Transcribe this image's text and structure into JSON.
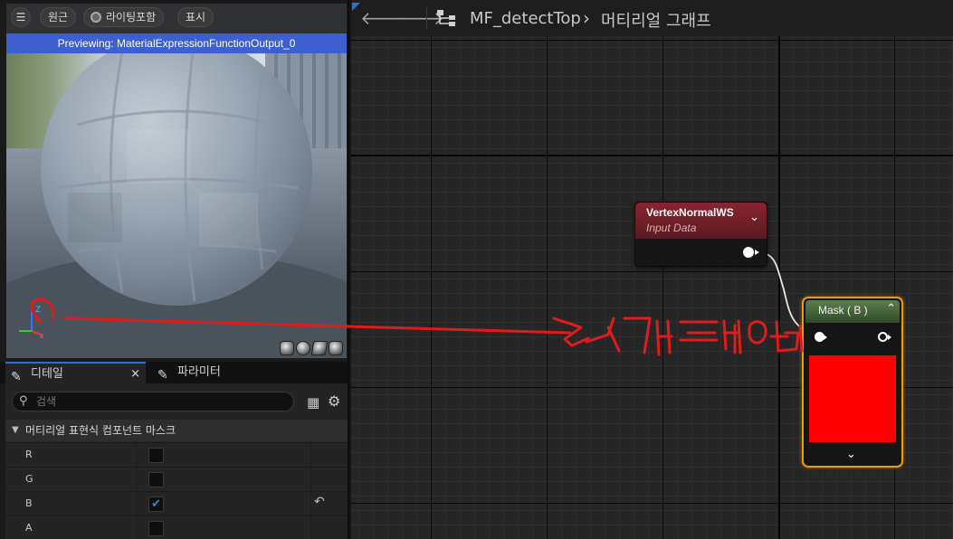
{
  "viewport": {
    "menu_glyph": "☰",
    "perspective_label": "원근",
    "lighting_label": "라이팅포함",
    "show_label": "표시",
    "preview_banner": "Previewing: MaterialExpressionFunctionOutput_0",
    "axis_z": "Z",
    "axis_x": "X",
    "preview_shapes": [
      "cylinder-icon",
      "sphere-icon",
      "plane-icon",
      "cube-icon"
    ]
  },
  "tabs": {
    "details_label": "디테일",
    "close_glyph": "×",
    "parameters_label": "파라미터"
  },
  "details": {
    "search_placeholder": "검색",
    "section_title": "머티리얼 표현식 컴포넌트 마스크",
    "rows": [
      {
        "label": "R",
        "checked": false
      },
      {
        "label": "G",
        "checked": false
      },
      {
        "label": "B",
        "checked": true
      },
      {
        "label": "A",
        "checked": false
      }
    ]
  },
  "graph": {
    "breadcrumb_asset": "MF_detectTop",
    "breadcrumb_sep": "›",
    "breadcrumb_view": "머티리얼 그래프",
    "node_vertex": {
      "title": "VertexNormalWS",
      "subtitle": "Input Data"
    },
    "node_mask": {
      "title": "Mask ( B )",
      "swatch_color": "#ff0000"
    },
    "annotation_color": "#e01b1b"
  },
  "colors": {
    "accent": "#2e6fd6",
    "preview_banner": "#3e5fcf",
    "selection_outline": "#e89a1a",
    "vertex_header": "#8a2430",
    "mask_header": "#5c7f4d"
  }
}
